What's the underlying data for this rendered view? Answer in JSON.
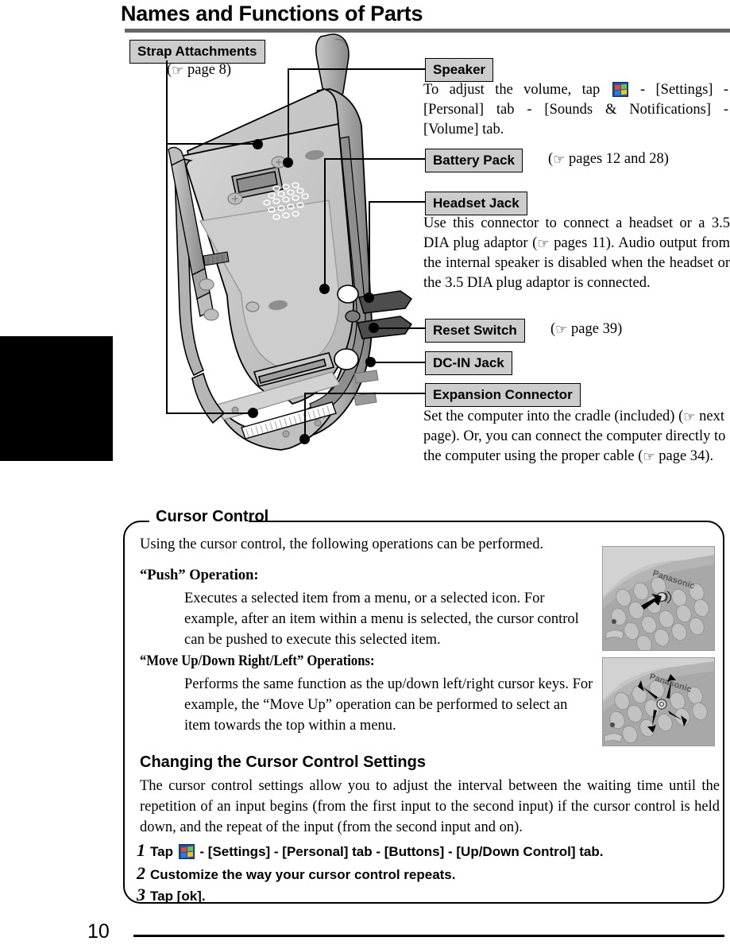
{
  "page": {
    "title": "Names and Functions of Parts",
    "number": "10"
  },
  "callouts": [
    {
      "id": "strap-attachments",
      "label": "Strap  Attachments",
      "reference": "page 8"
    },
    {
      "id": "speaker",
      "label": "Speaker",
      "body": "To adjust the volume, tap  - [Settings] - [Personal] tab - [Sounds & Notifications] - [Volume] tab.",
      "body_before_icon": "To adjust the volume, tap ",
      "body_after_icon": " - [Settings] - [Personal] tab - [Sounds & Notifications] - [Volume] tab.",
      "icon": "windows-logo-icon"
    },
    {
      "id": "battery-pack",
      "label": "Battery Pack",
      "reference": "pages 12 and 28"
    },
    {
      "id": "headset-jack",
      "label": "Headset Jack",
      "body": "Use this connector to connect a headset or a 3.5 DIA plug adaptor (☞ pages 11). Audio output from the internal speaker is disabled when the headset or the 3.5 DIA plug adaptor is connected.",
      "body_part1": "Use this connector to connect a headset or a 3.5 DIA plug adaptor (",
      "body_part2": " pages 11). Audio output from the internal speaker is disabled when the headset or the 3.5 DIA plug adaptor is connected."
    },
    {
      "id": "reset-switch",
      "label": "Reset Switch",
      "reference": "page 39"
    },
    {
      "id": "dc-in-jack",
      "label": "DC-IN Jack"
    },
    {
      "id": "expansion-connector",
      "label": "Expansion Connector",
      "body_part1": "Set the computer into the cradle (included) (",
      "body_part2": " next page). Or, you can connect the computer directly to the computer using the proper cable (",
      "body_part3": " page 34)."
    }
  ],
  "cursor_control": {
    "title": "Cursor Control",
    "intro": "Using the cursor control, the following operations can be performed.",
    "push": {
      "heading": "“Push” Operation:",
      "body": "Executes a selected item from a menu, or a selected icon. For example, after an item within a menu is selected, the cursor control can be pushed to execute this selected item."
    },
    "move": {
      "heading": "“Move Up/Down Right/Left” Operations:",
      "body": "Performs the same function as the up/down left/right cursor keys. For example, the “Move Up” operation can be performed to select an item towards the top within a menu."
    },
    "settings": {
      "heading": "Changing the Cursor Control Settings",
      "body": "The cursor control settings allow you to adjust the interval between the waiting  time until the repetition of an input begins (from the first input to the second input) if the cursor control is held down, and the repeat of the input (from the second input and on).",
      "steps": [
        {
          "number": "1",
          "text_before_icon": "Tap ",
          "icon": "windows-logo-icon",
          "text_after_icon": " - [Settings] - [Personal] tab - [Buttons] - [Up/Down Control] tab."
        },
        {
          "number": "2",
          "text": "Customize the way your cursor control repeats."
        },
        {
          "number": "3",
          "text": "Tap [ok]."
        }
      ]
    },
    "photos": [
      {
        "id": "push-photo",
        "brand": "Panasonic",
        "caption": "push-operation-illustration"
      },
      {
        "id": "move-photo",
        "brand": "Panasonic",
        "caption": "four-direction-operation-illustration"
      }
    ]
  },
  "glyphs": {
    "hand_pointer": "☞"
  },
  "colors": {
    "chip_fill": "#cccccc",
    "title_rule": "#666666",
    "device_body_light": "#d8d8d8",
    "device_body_mid": "#b0b0b0",
    "device_body_dark": "#8a8a8a"
  }
}
